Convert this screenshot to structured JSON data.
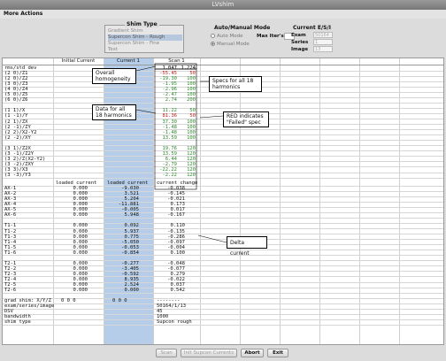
{
  "window": {
    "title": "LVshim"
  },
  "menu": {
    "label": "More Actions"
  },
  "shim_type": {
    "label": "Shim Type",
    "options": [
      "Gradient Shim",
      "Supercon Shim - Rough",
      "Supercon Shim - Fine",
      "Test"
    ],
    "selected_index": 1
  },
  "mode": {
    "label": "Auto/Manual Mode",
    "options": [
      "Auto Mode",
      "Manual Mode"
    ],
    "selected": "Manual Mode",
    "max_iter_label": "Max Iter's:"
  },
  "esi": {
    "label": "Current E/S/I",
    "fields": [
      {
        "name": "Exam",
        "value": "50164"
      },
      {
        "name": "Series",
        "value": "1"
      },
      {
        "name": "Image",
        "value": "13"
      }
    ]
  },
  "table": {
    "headers": [
      "Initial Current",
      "Current 1",
      "Scan 1"
    ],
    "harmonics": [
      {
        "label": "rms/std dev",
        "v1": "1.047",
        "v2": "1.224",
        "failed": false
      },
      {
        "label": "(2  0)/Z1",
        "v1": "-55.45",
        "v2": "50",
        "failed": true
      },
      {
        "label": "(2  0)/Z2",
        "v1": "-19.30",
        "v2": "100",
        "failed": false
      },
      {
        "label": "(3  0)/Z3",
        "v1": "-1.95",
        "v2": "100",
        "failed": false
      },
      {
        "label": "(4  0)/Z4",
        "v1": "-2.96",
        "v2": "100",
        "failed": false
      },
      {
        "label": "(5  0)/Z5",
        "v1": "-2.47",
        "v2": "100",
        "failed": false
      },
      {
        "label": "(6  0)/Z6",
        "v1": "2.74",
        "v2": "200",
        "failed": false
      },
      {
        "label": "(1  1)/X",
        "v1": "11.22",
        "v2": "50",
        "failed": false
      },
      {
        "label": "(1 -1)/Y",
        "v1": "81.36",
        "v2": "50",
        "failed": true
      },
      {
        "label": "(2  1)/ZX",
        "v1": "37.30",
        "v2": "100",
        "failed": false
      },
      {
        "label": "(2 -1)/ZY",
        "v1": "-1.48",
        "v2": "100",
        "failed": false
      },
      {
        "label": "(2  2)/X2-Y2",
        "v1": "-1.48",
        "v2": "100",
        "failed": false
      },
      {
        "label": "(2 -2)/XY",
        "v1": "13.59",
        "v2": "100",
        "failed": false
      },
      {
        "label": "(3  1)/Z2X",
        "v1": "19.76",
        "v2": "120",
        "failed": false
      },
      {
        "label": "(3 -1)/Z2Y",
        "v1": "13.59",
        "v2": "120",
        "failed": false
      },
      {
        "label": "(3  2)/Z(X2-Y2)",
        "v1": "6.44",
        "v2": "120",
        "failed": false
      },
      {
        "label": "(3 -2)/ZXY",
        "v1": "-2.79",
        "v2": "120",
        "failed": false
      },
      {
        "label": "(3  3)/X3",
        "v1": "-22.22",
        "v2": "120",
        "failed": false
      },
      {
        "label": "(3 -3)/Y3",
        "v1": "-2.22",
        "v2": "120",
        "failed": false
      }
    ],
    "current_headers": [
      "loaded current",
      "loaded current",
      "current change"
    ],
    "current_groups": [
      [
        {
          "label": "AX-1",
          "initial": "0.000",
          "current": "-9.030",
          "change": "-0.038"
        },
        {
          "label": "AX-2",
          "initial": "0.000",
          "current": "3.521",
          "change": "-0.145"
        },
        {
          "label": "AX-3",
          "initial": "0.000",
          "current": "5.204",
          "change": "-0.021"
        },
        {
          "label": "AX-4",
          "initial": "0.000",
          "current": "-11.881",
          "change": "0.173"
        },
        {
          "label": "AX-5",
          "initial": "0.000",
          "current": "-0.005",
          "change": "0.017"
        },
        {
          "label": "AX-6",
          "initial": "0.000",
          "current": "5.948",
          "change": "-0.167"
        }
      ],
      [
        {
          "label": "T1-1",
          "initial": "0.000",
          "current": "0.092",
          "change": "0.110"
        },
        {
          "label": "T1-2",
          "initial": "0.000",
          "current": "5.937",
          "change": "-0.135"
        },
        {
          "label": "T1-3",
          "initial": "0.000",
          "current": "0.775",
          "change": "-0.286"
        },
        {
          "label": "T1-4",
          "initial": "0.000",
          "current": "-5.050",
          "change": "-0.097"
        },
        {
          "label": "T1-5",
          "initial": "0.000",
          "current": "-0.053",
          "change": "-0.004"
        },
        {
          "label": "T1-6",
          "initial": "0.000",
          "current": "-0.854",
          "change": "0.100"
        }
      ],
      [
        {
          "label": "T2-1",
          "initial": "0.000",
          "current": "-0.277",
          "change": "-0.048"
        },
        {
          "label": "T2-2",
          "initial": "0.000",
          "current": "-3.405",
          "change": "-0.077"
        },
        {
          "label": "T2-3",
          "initial": "0.000",
          "current": "-0.592",
          "change": "0.279"
        },
        {
          "label": "T2-4",
          "initial": "0.000",
          "current": "8.935",
          "change": "-0.022"
        },
        {
          "label": "T2-5",
          "initial": "0.000",
          "current": "2.524",
          "change": "0.037"
        },
        {
          "label": "T2-6",
          "initial": "0.000",
          "current": "0.000",
          "change": "0.542"
        }
      ]
    ],
    "footer": [
      {
        "label": "grad shim: X/Y/Z",
        "initial": "0   0   0",
        "current": "0   0   0",
        "change": "--------"
      },
      {
        "label": "exam/series/image",
        "initial": "",
        "current": "",
        "change": "50164/1/13"
      },
      {
        "label": "DSV",
        "initial": "",
        "current": "",
        "change": "45"
      },
      {
        "label": "bandwidth",
        "initial": "",
        "current": "",
        "change": "1000"
      },
      {
        "label": "shim type",
        "initial": "",
        "current": "",
        "change": "Supcon rough"
      }
    ]
  },
  "annotations": {
    "homogeneity": "Overall homogeneity",
    "specs": "Specs for all 18 harmonics",
    "data": "Data for all 18 harmonics",
    "red": "RED indicates \"Failed\" spec",
    "delta": "Delta current"
  },
  "buttons": {
    "scan": "Scan",
    "init": "Init Supcon Currents",
    "abort": "Abort",
    "exit": "Exit"
  },
  "colors": {
    "pass": "#2a8a2a",
    "fail": "#c01818",
    "highlight": "#b5cde8"
  }
}
